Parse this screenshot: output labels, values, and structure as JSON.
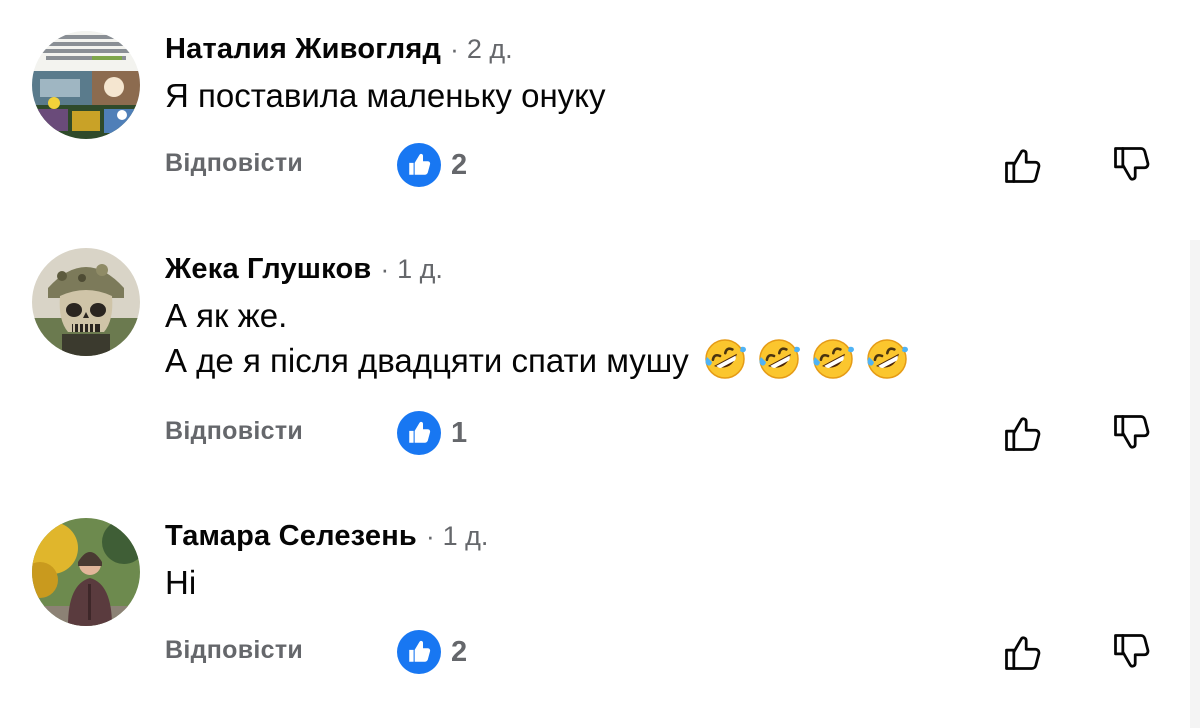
{
  "comments": [
    {
      "author": "Наталия Живогляд",
      "separator": "·",
      "time": "2 д.",
      "lines": [
        "Я поставила маленьку онуку"
      ],
      "reply_label": "Відповісти",
      "like_count": "2",
      "avatar_icon": "collage-photo-avatar"
    },
    {
      "author": "Жека Глушков",
      "separator": "·",
      "time": "1 д.",
      "lines": [
        "А як же.",
        "А де я після двадцяти спати мушу"
      ],
      "emojis": [
        "rolling-on-floor-laughing",
        "rolling-on-floor-laughing",
        "rolling-on-floor-laughing",
        "rolling-on-floor-laughing"
      ],
      "reply_label": "Відповісти",
      "like_count": "1",
      "avatar_icon": "skull-helmet-avatar"
    },
    {
      "author": "Тамара Селезень",
      "separator": "·",
      "time": "1 д.",
      "lines": [
        "Ні"
      ],
      "reply_label": "Відповісти",
      "like_count": "2",
      "avatar_icon": "woman-outdoor-avatar"
    }
  ],
  "colors": {
    "like_blue": "#1877f2",
    "secondary_text": "#65676b",
    "primary_text": "#050505"
  }
}
